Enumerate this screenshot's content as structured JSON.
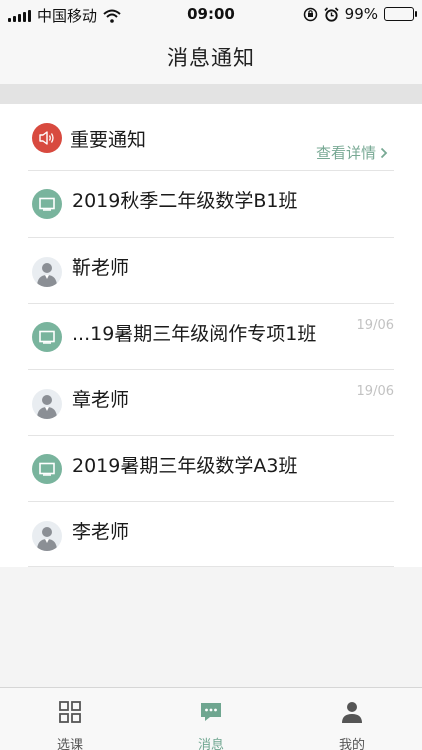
{
  "status_bar": {
    "carrier": "中国移动",
    "time": "09:00",
    "battery_percent": "99%",
    "battery_level": 0.99
  },
  "header": {
    "title": "消息通知"
  },
  "notice": {
    "title": "重要通知",
    "details_label": "查看详情",
    "icon": "speaker-icon",
    "icon_color": "#d84a3f"
  },
  "conversations": [
    {
      "title": "2019秋季二年级数学B1班",
      "type": "class",
      "date": ""
    },
    {
      "title": "靳老师",
      "type": "teacher",
      "date": ""
    },
    {
      "title": "...19暑期三年级阅作专项1班",
      "type": "class",
      "date": "19/06"
    },
    {
      "title": "章老师",
      "type": "teacher",
      "date": "19/06"
    },
    {
      "title": "2019暑期三年级数学A3班",
      "type": "class",
      "date": ""
    },
    {
      "title": "李老师",
      "type": "teacher",
      "date": ""
    }
  ],
  "tabs": [
    {
      "label": "选课",
      "icon": "grid-icon",
      "active": false
    },
    {
      "label": "消息",
      "icon": "message-icon",
      "active": true
    },
    {
      "label": "我的",
      "icon": "person-icon",
      "active": false
    }
  ],
  "colors": {
    "accent": "#6fa690",
    "class_icon": "#79b49d",
    "notice_icon": "#d84a3f"
  }
}
